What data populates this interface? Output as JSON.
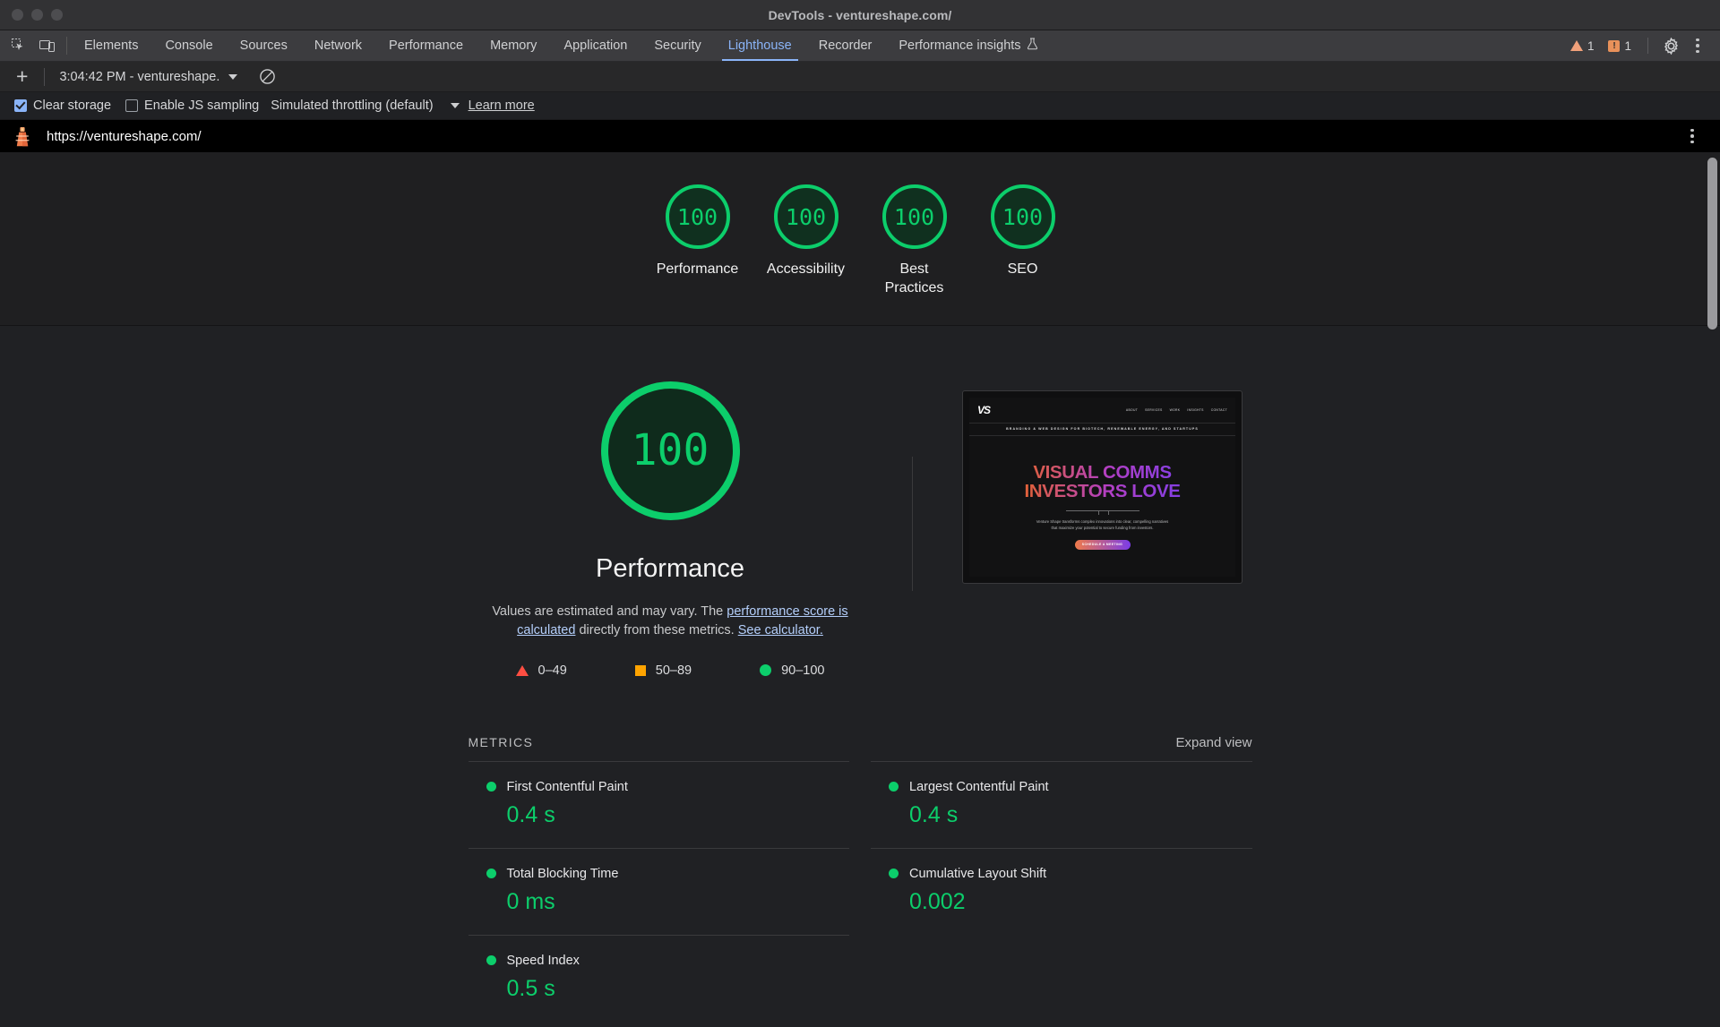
{
  "window": {
    "title": "DevTools - ventureshape.com/"
  },
  "tabbar": {
    "inspect_icon": "inspect-cursor-icon",
    "device_icon": "device-toolbar-icon",
    "tabs": [
      {
        "label": "Elements",
        "active": false
      },
      {
        "label": "Console",
        "active": false
      },
      {
        "label": "Sources",
        "active": false
      },
      {
        "label": "Network",
        "active": false
      },
      {
        "label": "Performance",
        "active": false
      },
      {
        "label": "Memory",
        "active": false
      },
      {
        "label": "Application",
        "active": false
      },
      {
        "label": "Security",
        "active": false
      },
      {
        "label": "Lighthouse",
        "active": true
      },
      {
        "label": "Recorder",
        "active": false
      },
      {
        "label": "Performance insights",
        "active": false,
        "icon": "flask-icon"
      }
    ],
    "warning_count": "1",
    "issue_count": "1",
    "settings_icon": "gear-icon",
    "more_icon": "kebab-menu-icon"
  },
  "panel_toolbar": {
    "new_report_label": "+",
    "run_label": "3:04:42 PM - ventureshape.",
    "clear_icon": "clear-prohibited-icon"
  },
  "settings": {
    "clear_storage": {
      "label": "Clear storage",
      "checked": true
    },
    "js_sampling": {
      "label": "Enable JS sampling",
      "checked": false
    },
    "throttling": "Simulated throttling (default)",
    "learn_more": "Learn more"
  },
  "urlbar": {
    "icon": "lighthouse-icon",
    "url": "https://ventureshape.com/",
    "more_icon": "kebab-menu-icon"
  },
  "score_strip": [
    {
      "score": "100",
      "label": "Performance"
    },
    {
      "score": "100",
      "label": "Accessibility"
    },
    {
      "score": "100",
      "label": "Best\nPractices"
    },
    {
      "score": "100",
      "label": "SEO"
    }
  ],
  "hero": {
    "score": "100",
    "title": "Performance",
    "desc_part1": "Values are estimated and may vary. The ",
    "desc_link1": "performance score is calculated",
    "desc_part2": " directly from these metrics. ",
    "desc_link2": "See calculator.",
    "legend": [
      {
        "icon": "triangle-red-icon",
        "range": "0–49",
        "color": "#ff4e42"
      },
      {
        "icon": "square-orange-icon",
        "range": "50–89",
        "color": "#ffa400"
      },
      {
        "icon": "circle-green-icon",
        "range": "90–100",
        "color": "#0cce6b"
      }
    ]
  },
  "thumbnail": {
    "logo": "VS",
    "nav": [
      "ABOUT",
      "SERVICES",
      "WORK",
      "INSIGHTS",
      "CONTACT"
    ],
    "tagline": "BRANDING & WEB DESIGN FOR BIOTECH, RENEWABLE ENERGY, AND STARTUPS",
    "headline_line1": "VISUAL COMMS",
    "headline_line2": "INVESTORS LOVE",
    "body": "Venture Shape transforms complex innovations into clear, compelling narratives that maximize your potential to secure funding from investors.",
    "cta": "SCHEDULE A MEETING"
  },
  "metrics": {
    "title": "METRICS",
    "expand_label": "Expand view",
    "left": [
      {
        "name": "First Contentful Paint",
        "value": "0.4 s",
        "status": "pass"
      },
      {
        "name": "Total Blocking Time",
        "value": "0 ms",
        "status": "pass"
      },
      {
        "name": "Speed Index",
        "value": "0.5 s",
        "status": "pass"
      }
    ],
    "right": [
      {
        "name": "Largest Contentful Paint",
        "value": "0.4 s",
        "status": "pass"
      },
      {
        "name": "Cumulative Layout Shift",
        "value": "0.002",
        "status": "pass"
      }
    ]
  },
  "colors": {
    "pass": "#0cce6b",
    "average": "#ffa400",
    "fail": "#ff4e42",
    "accent": "#8ab4f8"
  }
}
